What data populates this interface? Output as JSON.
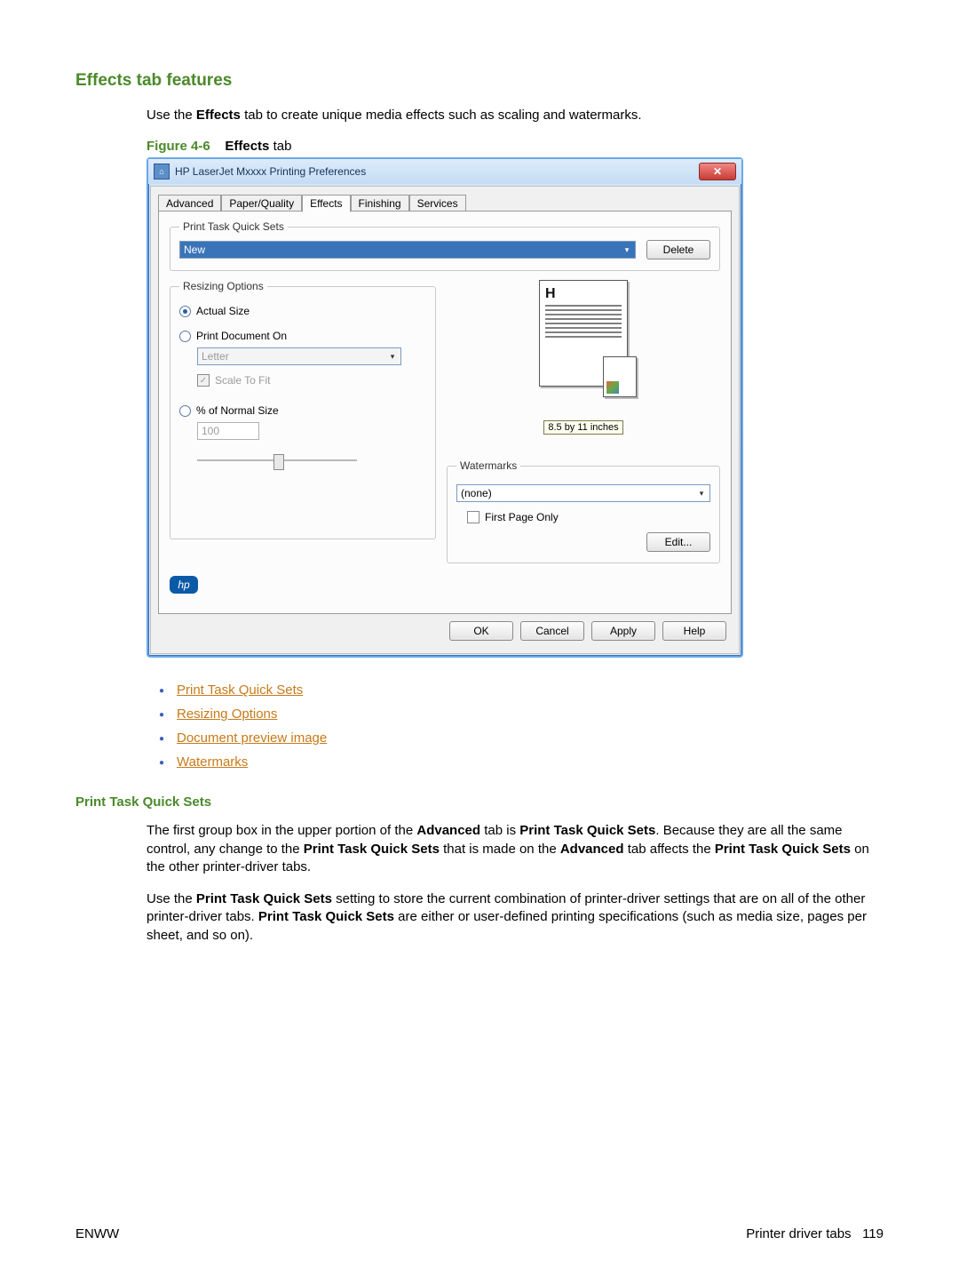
{
  "heading": "Effects tab features",
  "intro_pre": "Use the ",
  "intro_bold1": "Effects",
  "intro_post": " tab to create unique media effects such as scaling and watermarks.",
  "figure": {
    "num": "Figure 4-6",
    "bold": "Effects",
    "rest": " tab"
  },
  "dialog": {
    "title": "HP LaserJet Mxxxx Printing Preferences",
    "tabs": [
      "Advanced",
      "Paper/Quality",
      "Effects",
      "Finishing",
      "Services"
    ],
    "active_tab": 2,
    "quicksets": {
      "legend": "Print Task Quick Sets",
      "value": "New",
      "delete": "Delete"
    },
    "resize": {
      "legend": "Resizing Options",
      "actual": "Actual Size",
      "printdoc": "Print Document On",
      "paper": "Letter",
      "scale": "Scale To Fit",
      "pct": "% of Normal Size",
      "pct_val": "100"
    },
    "preview_label": "8.5 by 11 inches",
    "watermarks": {
      "legend": "Watermarks",
      "value": "(none)",
      "first_page": "First Page Only",
      "edit": "Edit..."
    },
    "hp": "hp",
    "buttons": {
      "ok": "OK",
      "cancel": "Cancel",
      "apply": "Apply",
      "help": "Help"
    }
  },
  "links": [
    "Print Task Quick Sets",
    "Resizing Options",
    "Document preview image",
    "Watermarks"
  ],
  "sub_heading": "Print Task Quick Sets",
  "para1": "The first group box in the upper portion of the <b>Advanced</b> tab is <b>Print Task Quick Sets</b>. Because they are all the same control, any change to the <b>Print Task Quick Sets</b> that is made on the <b>Advanced</b> tab affects the <b>Print Task Quick Sets</b> on the other printer-driver tabs.",
  "para2": "Use the <b>Print Task Quick Sets</b> setting to store the current combination of printer-driver settings that are on all of the other printer-driver tabs. <b>Print Task Quick Sets</b> are either or user-defined printing specifications (such as media size, pages per sheet, and so on).",
  "footer": {
    "left": "ENWW",
    "right_text": "Printer driver tabs",
    "right_num": "119"
  }
}
